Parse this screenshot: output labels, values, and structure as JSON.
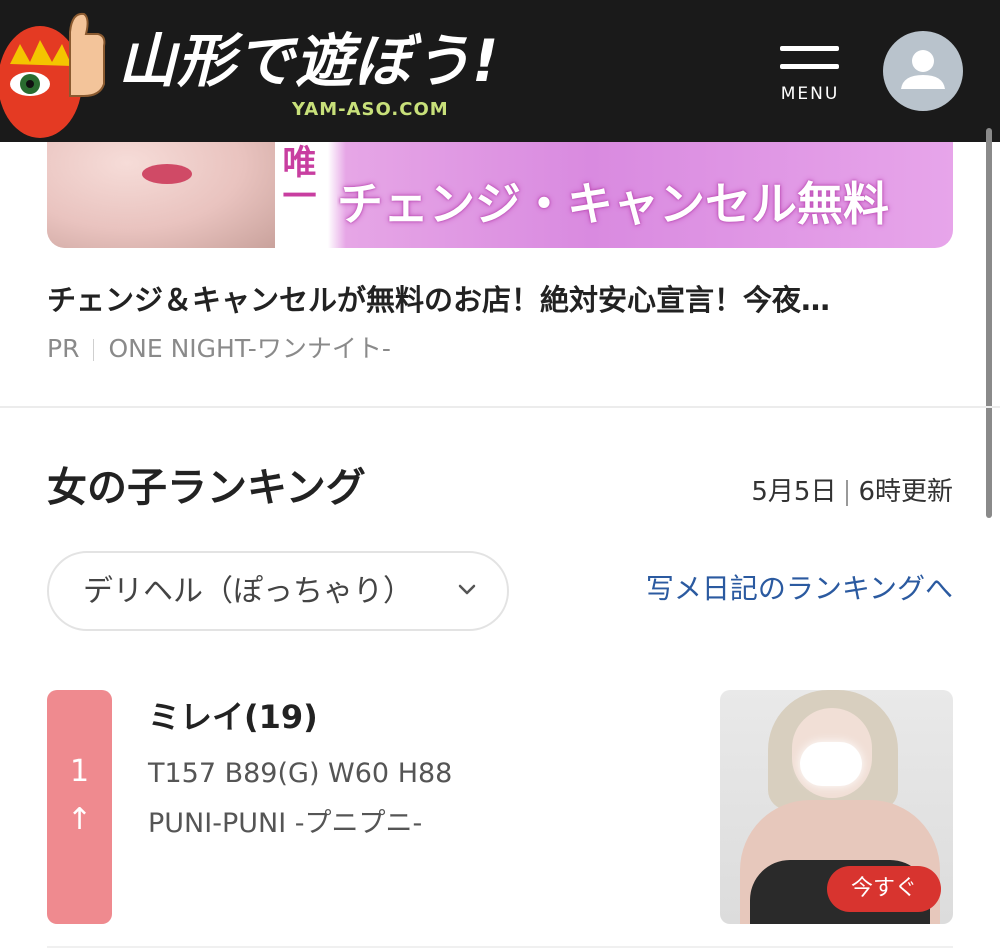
{
  "header": {
    "site_title": "山形で遊ぼう!",
    "site_domain": "YAM-ASO.COM",
    "menu_label": "MENU",
    "icons": {
      "mascot": "mascot-logo-icon",
      "menu": "hamburger-icon",
      "account": "user-icon"
    },
    "colors": {
      "background": "#1a1a1a",
      "domain": "#c8e07a"
    }
  },
  "banner": {
    "vertical_text": "唯一",
    "text": "チェンジ・キャンセル無料"
  },
  "pr": {
    "title": "チェンジ＆キャンセルが無料のお店！絶対安心宣言！今夜…",
    "label": "PR",
    "shop": "ONE NIGHT-ワンナイト-"
  },
  "ranking": {
    "title": "女の子ランキング",
    "update_date": "5月5日",
    "update_time": "6時更新",
    "category_selected": "デリヘル（ぽっちゃり）",
    "diary_link": "写メ日記のランキングへ",
    "accent_color": "#ef8a8f",
    "link_color": "#2b5aa0",
    "entries": [
      {
        "rank": "1",
        "trend": "↑",
        "name": "ミレイ(19)",
        "spec": "T157 B89(G) W60 H88",
        "shop": "PUNI-PUNI -プニプニ-",
        "badge": "今すぐ"
      }
    ]
  }
}
